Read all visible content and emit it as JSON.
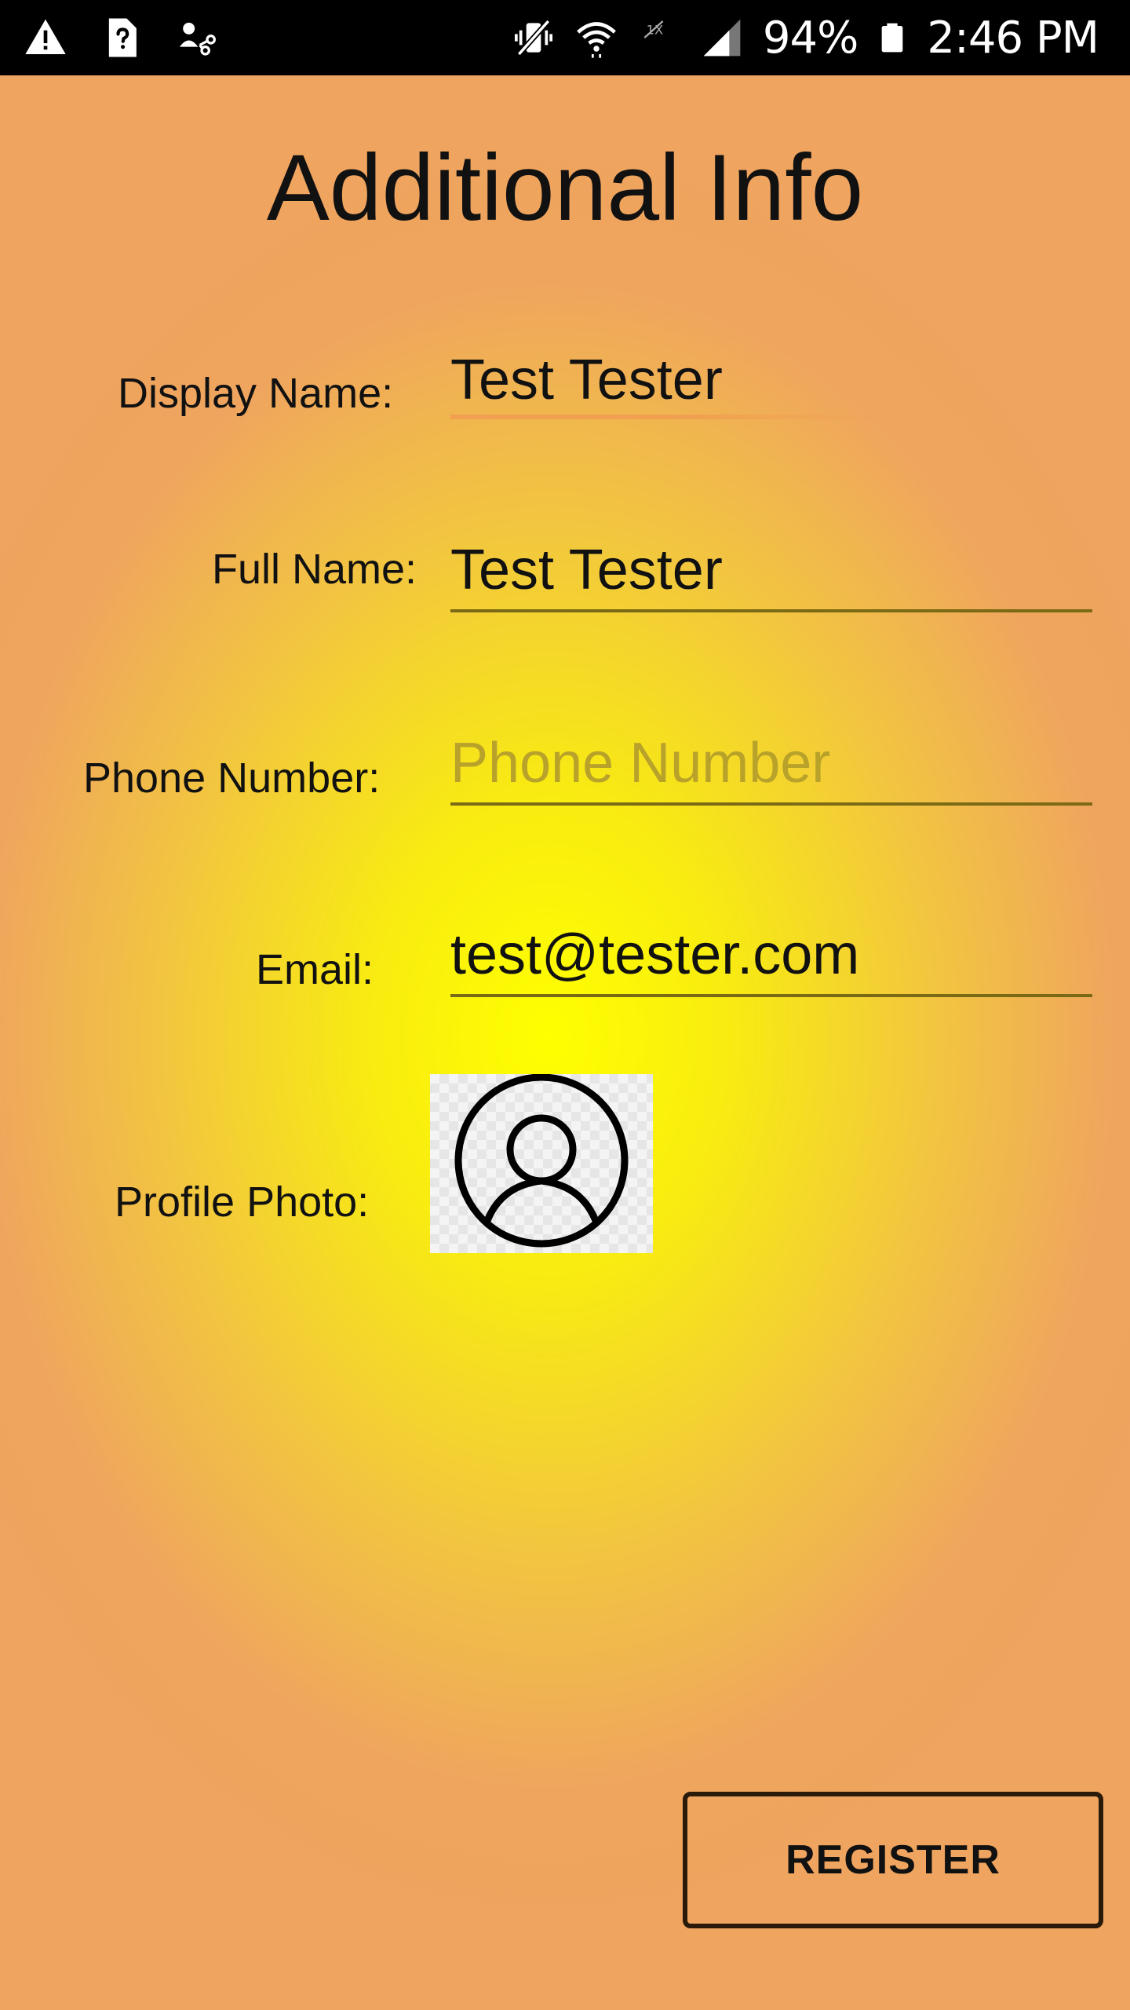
{
  "status_bar": {
    "icons_left": [
      "warning-icon",
      "unknown-sim-icon",
      "share-icon"
    ],
    "icons_right": [
      "vibrate-icon",
      "wifi-icon",
      "no-signal-icon",
      "cell-signal-icon",
      "battery-icon"
    ],
    "battery": "94%",
    "time": "2:46 PM"
  },
  "page": {
    "title": "Additional Info"
  },
  "form": {
    "display_name": {
      "label": "Display Name:",
      "value": "Test Tester",
      "placeholder": ""
    },
    "full_name": {
      "label": "Full Name:",
      "value": "Test Tester",
      "placeholder": ""
    },
    "phone_number": {
      "label": "Phone Number:",
      "value": "",
      "placeholder": "Phone Number"
    },
    "email": {
      "label": "Email:",
      "value": "test@tester.com",
      "placeholder": ""
    },
    "profile_photo": {
      "label": "Profile Photo:",
      "icon": "user-avatar-icon"
    }
  },
  "actions": {
    "register_label": "REGISTER"
  },
  "colors": {
    "background_center": "#ffff00",
    "background_edge": "#efa45f",
    "text": "#111111",
    "placeholder": "#b8a22a",
    "underline": "#7a6a15"
  }
}
